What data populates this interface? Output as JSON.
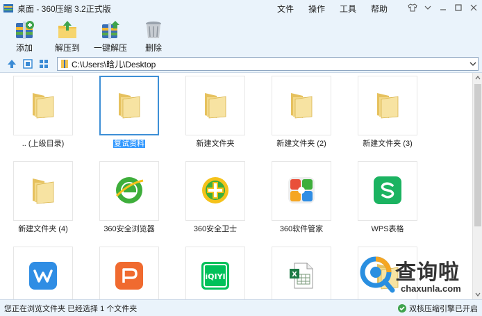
{
  "window": {
    "title": "桌面 - 360压缩 3.2正式版",
    "menu": [
      "文件",
      "操作",
      "工具",
      "帮助"
    ]
  },
  "toolbar": {
    "add": "添加",
    "extract_to": "解压到",
    "one_click_extract": "一键解压",
    "delete": "删除"
  },
  "address": {
    "path": "C:\\Users\\晗儿\\Desktop"
  },
  "files": [
    {
      "name": ".. (上级目录)",
      "icon": "folder-icon"
    },
    {
      "name": "复试资料",
      "icon": "folder-icon",
      "selected": true
    },
    {
      "name": "新建文件夹",
      "icon": "folder-icon"
    },
    {
      "name": "新建文件夹 (2)",
      "icon": "folder-icon"
    },
    {
      "name": "新建文件夹 (3)",
      "icon": "folder-icon"
    },
    {
      "name": "新建文件夹 (4)",
      "icon": "folder-icon"
    },
    {
      "name": "360安全浏览器",
      "icon": "360-browser-icon"
    },
    {
      "name": "360安全卫士",
      "icon": "360-safe-icon"
    },
    {
      "name": "360软件管家",
      "icon": "360-software-manager-icon"
    },
    {
      "name": "WPS表格",
      "icon": "wps-spreadsheet-icon"
    },
    {
      "name": "",
      "icon": "wps-writer-icon"
    },
    {
      "name": "",
      "icon": "wps-presentation-icon"
    },
    {
      "name": "",
      "icon": "iqiyi-icon"
    },
    {
      "name": "",
      "icon": "excel-file-icon"
    },
    {
      "name": "",
      "icon": "folder-icon"
    }
  ],
  "status": {
    "text": "您正在浏览文件夹 已经选择 1 个文件夹",
    "engine": "双核压缩引擎已开启"
  },
  "watermark": {
    "main": "查询啦",
    "sub": "chaxunla.com"
  },
  "colors": {
    "chrome": "#eaf3fb",
    "selection": "#3399ff",
    "selected_border": "#3d8fd6"
  }
}
